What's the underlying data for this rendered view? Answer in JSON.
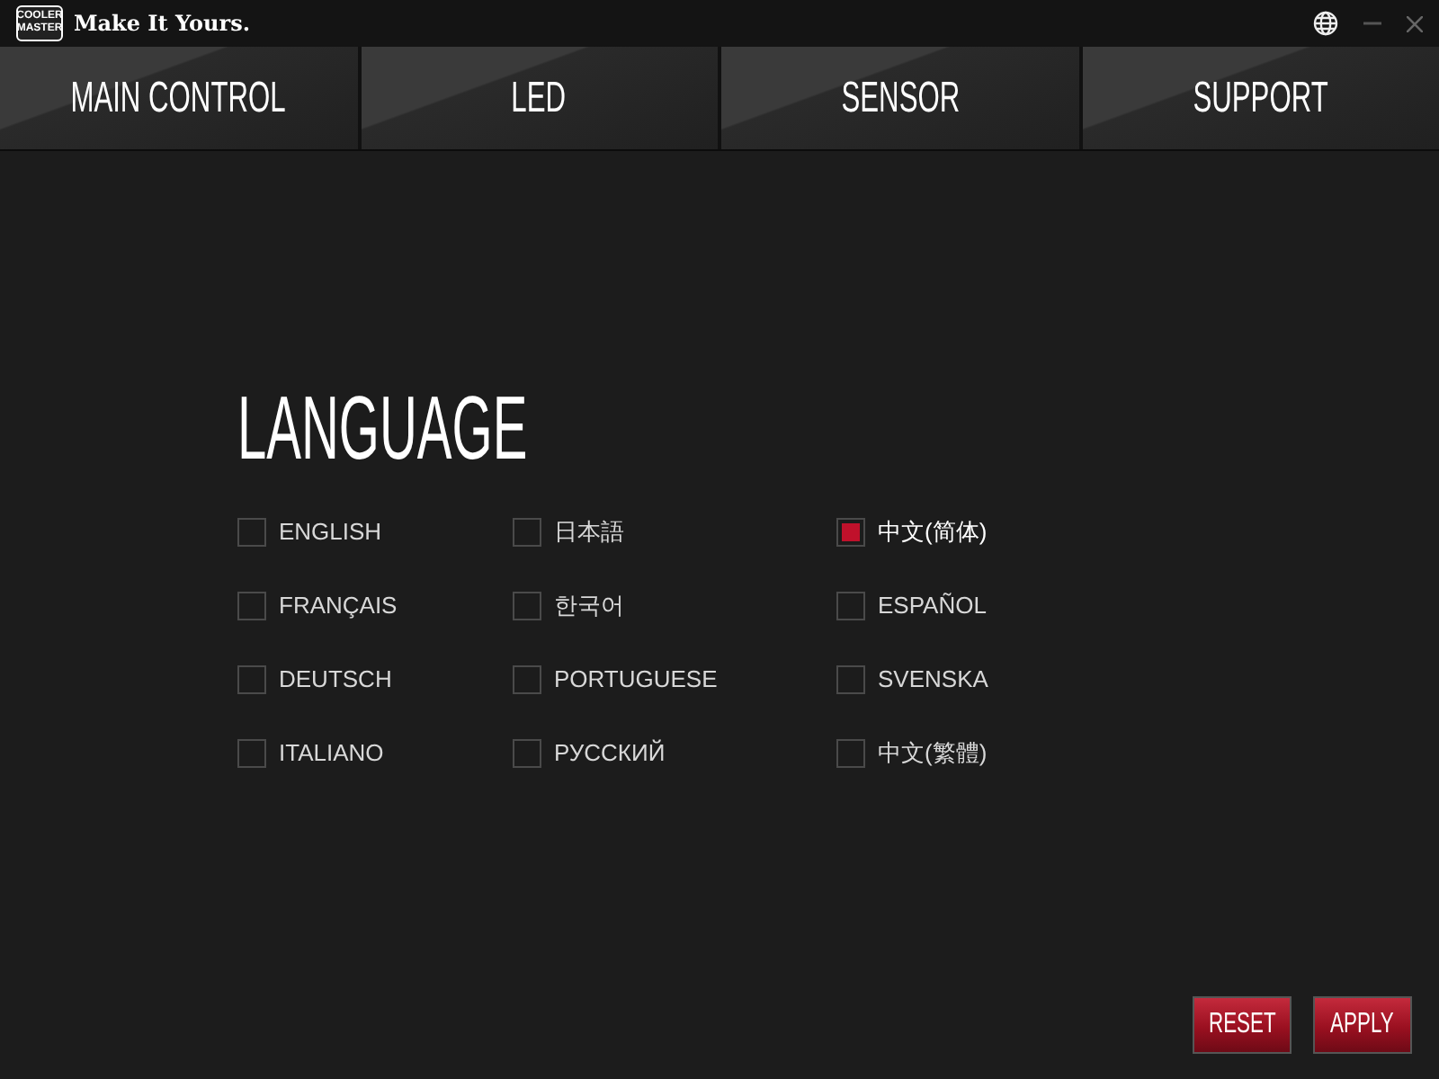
{
  "window": {
    "logo": [
      "COOLER",
      "MASTER"
    ],
    "title": "Make It Yours."
  },
  "tabs": [
    {
      "label": "MAIN CONTROL"
    },
    {
      "label": "LED"
    },
    {
      "label": "SENSOR"
    },
    {
      "label": "SUPPORT"
    }
  ],
  "heading": "LANGUAGE",
  "languages": [
    {
      "label": "ENGLISH",
      "checked": false
    },
    {
      "label": "日本語",
      "checked": false
    },
    {
      "label": "中文(简体)",
      "checked": true
    },
    {
      "label": "FRANÇAIS",
      "checked": false
    },
    {
      "label": "한국어",
      "checked": false
    },
    {
      "label": "ESPAÑOL",
      "checked": false
    },
    {
      "label": "DEUTSCH",
      "checked": false
    },
    {
      "label": "PORTUGUESE",
      "checked": false
    },
    {
      "label": "SVENSKA",
      "checked": false
    },
    {
      "label": "ITALIANO",
      "checked": false
    },
    {
      "label": "РУССКИЙ",
      "checked": false
    },
    {
      "label": "中文(繁體)",
      "checked": false
    }
  ],
  "buttons": [
    "RESET",
    "APPLY"
  ]
}
